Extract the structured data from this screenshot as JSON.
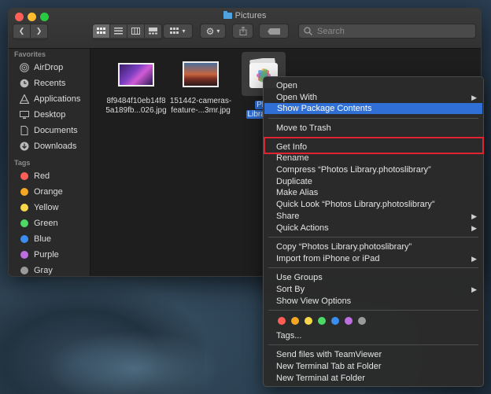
{
  "window": {
    "title": "Pictures"
  },
  "toolbar": {
    "search_placeholder": "Search"
  },
  "sidebar": {
    "favorites_header": "Favorites",
    "favorites": [
      {
        "label": "AirDrop",
        "icon": "airdrop-icon"
      },
      {
        "label": "Recents",
        "icon": "clock-icon"
      },
      {
        "label": "Applications",
        "icon": "applications-icon"
      },
      {
        "label": "Desktop",
        "icon": "desktop-icon"
      },
      {
        "label": "Documents",
        "icon": "document-icon"
      },
      {
        "label": "Downloads",
        "icon": "download-icon"
      }
    ],
    "tags_header": "Tags",
    "tags": [
      {
        "label": "Red",
        "color": "#ff5f57"
      },
      {
        "label": "Orange",
        "color": "#f5a623"
      },
      {
        "label": "Yellow",
        "color": "#f8d84a"
      },
      {
        "label": "Green",
        "color": "#4cd964"
      },
      {
        "label": "Blue",
        "color": "#3b8ef0"
      },
      {
        "label": "Purple",
        "color": "#bf6ee0"
      },
      {
        "label": "Gray",
        "color": "#9a9a9a"
      }
    ]
  },
  "files": [
    {
      "line1": "8f9484f10eb14f8",
      "line2": "5a189fb...026.jpg"
    },
    {
      "line1": "151442-cameras-",
      "line2": "feature-...3mr.jpg"
    },
    {
      "line1": "Pho",
      "line2": "Library...."
    }
  ],
  "context_menu": {
    "items": [
      {
        "label": "Open"
      },
      {
        "label": "Open With",
        "submenu": true
      },
      {
        "label": "Show Package Contents",
        "highlighted": true
      },
      {
        "label": "Move to Trash"
      },
      {
        "label": "Get Info"
      },
      {
        "label": "Rename"
      },
      {
        "label": "Compress “Photos Library.photoslibrary”"
      },
      {
        "label": "Duplicate"
      },
      {
        "label": "Make Alias"
      },
      {
        "label": "Quick Look “Photos Library.photoslibrary”"
      },
      {
        "label": "Share",
        "submenu": true
      },
      {
        "label": "Quick Actions",
        "submenu": true
      },
      {
        "label": "Copy “Photos Library.photoslibrary”"
      },
      {
        "label": "Import from iPhone or iPad",
        "submenu": true
      },
      {
        "label": "Use Groups"
      },
      {
        "label": "Sort By",
        "submenu": true
      },
      {
        "label": "Show View Options"
      },
      {
        "label": "Tags..."
      },
      {
        "label": "Send files with TeamViewer"
      },
      {
        "label": "New Terminal Tab at Folder"
      },
      {
        "label": "New Terminal at Folder"
      }
    ],
    "submenu_arrow": "▶",
    "tag_colors": [
      "#ff5f57",
      "#f5a623",
      "#f8d84a",
      "#4cd964",
      "#3b8ef0",
      "#bf6ee0",
      "#9a9a9a"
    ]
  },
  "highlight_color": "#e0242f",
  "selection_color": "#2f6fd6"
}
